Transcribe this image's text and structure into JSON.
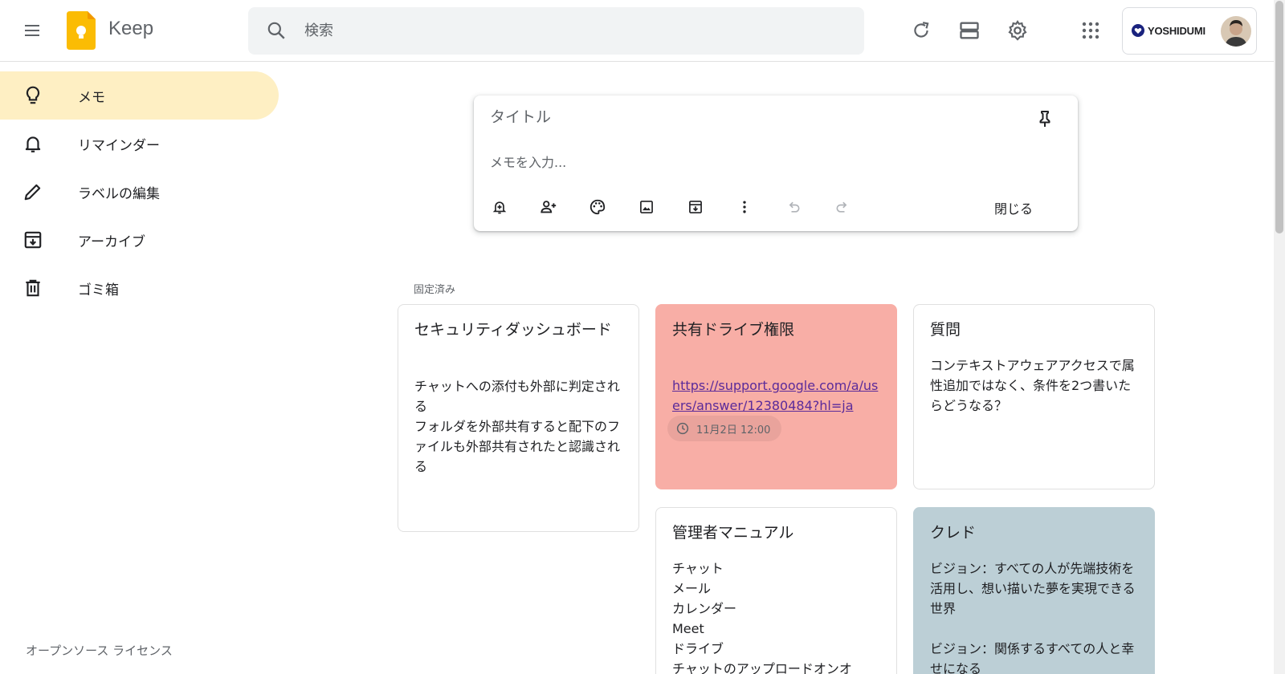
{
  "header": {
    "app_name": "Keep",
    "search_placeholder": "検索",
    "account_brand": "YOSHIDUMI"
  },
  "sidebar": {
    "items": [
      {
        "label": "メモ",
        "icon": "lightbulb-icon",
        "active": true
      },
      {
        "label": "リマインダー",
        "icon": "bell-icon",
        "active": false
      },
      {
        "label": "ラベルの編集",
        "icon": "pencil-icon",
        "active": false
      },
      {
        "label": "アーカイブ",
        "icon": "archive-icon",
        "active": false
      },
      {
        "label": "ゴミ箱",
        "icon": "trash-icon",
        "active": false
      }
    ],
    "license": "オープンソース ライセンス"
  },
  "composer": {
    "title_placeholder": "タイトル",
    "body_placeholder": "メモを入力...",
    "close_label": "閉じる"
  },
  "pinned_label": "固定済み",
  "notes": [
    {
      "title": "セキュリティダッシュボード",
      "body": "チャットへの添付も外部に判定される\nフォルダを外部共有すると配下のファイルも外部共有されたと認識される",
      "color": "#ffffff"
    },
    {
      "title": "共有ドライブ権限",
      "link": "https://support.google.com/a/users/answer/12380484?hl=ja",
      "reminder": "11月2日 12:00",
      "color": "#f8aea6"
    },
    {
      "title": "質問",
      "body": "コンテキストアウェアアクセスで属性追加ではなく、条件を2つ書いたらどうなる？",
      "color": "#ffffff"
    },
    {
      "title": "管理者マニュアル",
      "body": "チャット\nメール\nカレンダー\nMeet\nドライブ\nチャットのアップロードオンオ",
      "color": "#ffffff"
    },
    {
      "title": "クレド",
      "body": "ビジョン：すべての人が先端技術を活用し、想い描いた夢を実現できる世界\n\nビジョン：関係するすべての人と幸せになる",
      "color": "#bccfd6"
    }
  ],
  "colors": {
    "active_nav": "#feefc3",
    "logo_yellow": "#fbbc04"
  }
}
